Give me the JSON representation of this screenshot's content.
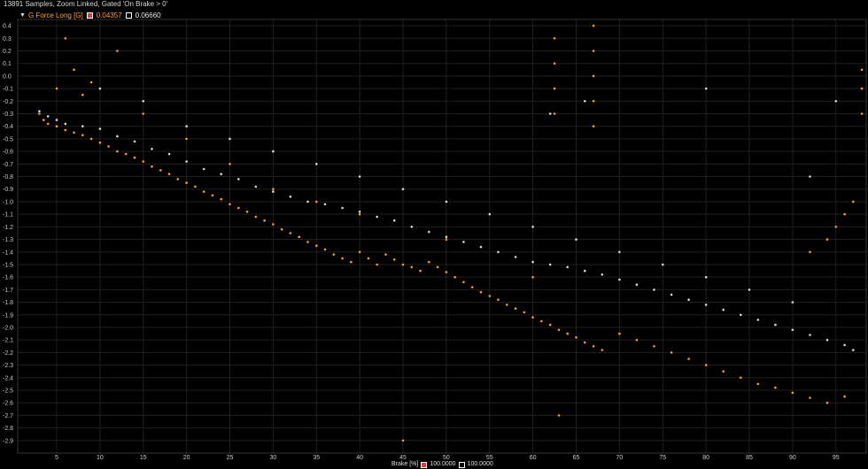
{
  "header": {
    "text": "13891 Samples, Zoom Linked, Gated 'On Brake > 0'"
  },
  "legend": {
    "arrow": "▼",
    "channel": "G Force Long [G]",
    "cursor_value_red": "0.04357",
    "cursor_value_white": "0.06660"
  },
  "x_footer": {
    "label": "Brake [%]",
    "cursor_value_red": "100.0000",
    "cursor_value_white": "100.0000"
  },
  "colors": {
    "background": "#000000",
    "grid": "#1f1f1f",
    "series_orange": "#ff9a2e",
    "series_white": "#d8d8d8"
  },
  "chart_data": {
    "type": "scatter",
    "title": "",
    "xlabel": "Brake [%]",
    "ylabel": "G Force Long [G]",
    "xlim": [
      0.5,
      98.5
    ],
    "ylim": [
      -3.0,
      0.45
    ],
    "grid": true,
    "xticks": [
      5,
      10,
      15,
      20,
      25,
      30,
      35,
      40,
      45,
      50,
      55,
      60,
      65,
      70,
      75,
      80,
      85,
      90,
      95
    ],
    "yticks": [
      0.4,
      0.3,
      0.2,
      0.1,
      0.0,
      -0.1,
      -0.2,
      -0.3,
      -0.4,
      -0.5,
      -0.6,
      -0.7,
      -0.8,
      -0.9,
      -1.0,
      -1.1,
      -1.2,
      -1.3,
      -1.4,
      -1.5,
      -1.6,
      -1.7,
      -1.8,
      -1.9,
      -2.0,
      -2.1,
      -2.2,
      -2.3,
      -2.4,
      -2.5,
      -2.6,
      -2.7,
      -2.8,
      -2.9
    ],
    "series": [
      {
        "color": "#ff9a2e",
        "points": [
          [
            3,
            -0.3
          ],
          [
            3.5,
            -0.35
          ],
          [
            4,
            -0.38
          ],
          [
            5,
            -0.4
          ],
          [
            6,
            -0.43
          ],
          [
            7,
            -0.45
          ],
          [
            8,
            -0.47
          ],
          [
            9,
            -0.5
          ],
          [
            10,
            -0.53
          ],
          [
            11,
            -0.56
          ],
          [
            12,
            -0.6
          ],
          [
            13,
            -0.62
          ],
          [
            14,
            -0.65
          ],
          [
            15,
            -0.68
          ],
          [
            16,
            -0.72
          ],
          [
            17,
            -0.75
          ],
          [
            18,
            -0.78
          ],
          [
            19,
            -0.82
          ],
          [
            20,
            -0.85
          ],
          [
            21,
            -0.88
          ],
          [
            22,
            -0.92
          ],
          [
            23,
            -0.95
          ],
          [
            24,
            -0.98
          ],
          [
            25,
            -1.02
          ],
          [
            26,
            -1.05
          ],
          [
            27,
            -1.08
          ],
          [
            28,
            -1.12
          ],
          [
            29,
            -1.15
          ],
          [
            30,
            -1.18
          ],
          [
            31,
            -1.22
          ],
          [
            32,
            -1.25
          ],
          [
            33,
            -1.28
          ],
          [
            34,
            -1.32
          ],
          [
            35,
            -1.35
          ],
          [
            36,
            -1.38
          ],
          [
            37,
            -1.42
          ],
          [
            38,
            -1.45
          ],
          [
            39,
            -1.48
          ],
          [
            40,
            -1.4
          ],
          [
            41,
            -1.45
          ],
          [
            42,
            -1.5
          ],
          [
            43,
            -1.42
          ],
          [
            44,
            -1.46
          ],
          [
            45,
            -1.5
          ],
          [
            46,
            -1.52
          ],
          [
            47,
            -1.55
          ],
          [
            48,
            -1.48
          ],
          [
            49,
            -1.52
          ],
          [
            50,
            -1.56
          ],
          [
            51,
            -1.6
          ],
          [
            52,
            -1.64
          ],
          [
            53,
            -1.68
          ],
          [
            54,
            -1.72
          ],
          [
            55,
            -1.75
          ],
          [
            56,
            -1.78
          ],
          [
            57,
            -1.82
          ],
          [
            58,
            -1.85
          ],
          [
            59,
            -1.88
          ],
          [
            60,
            -1.92
          ],
          [
            61,
            -1.95
          ],
          [
            62,
            -1.98
          ],
          [
            63,
            -2.02
          ],
          [
            64,
            -2.05
          ],
          [
            65,
            -2.08
          ],
          [
            66,
            -2.12
          ],
          [
            67,
            -2.15
          ],
          [
            68,
            -2.18
          ],
          [
            70,
            -2.05
          ],
          [
            72,
            -2.1
          ],
          [
            74,
            -2.15
          ],
          [
            76,
            -2.2
          ],
          [
            78,
            -2.25
          ],
          [
            80,
            -2.3
          ],
          [
            82,
            -2.35
          ],
          [
            84,
            -2.4
          ],
          [
            86,
            -2.45
          ],
          [
            88,
            -2.48
          ],
          [
            90,
            -2.52
          ],
          [
            92,
            -2.56
          ],
          [
            94,
            -2.6
          ],
          [
            96,
            -2.55
          ],
          [
            5,
            -0.1
          ],
          [
            7,
            0.05
          ],
          [
            9,
            -0.05
          ],
          [
            12,
            0.2
          ],
          [
            6,
            0.3
          ],
          [
            8,
            -0.15
          ],
          [
            15,
            -0.3
          ],
          [
            20,
            -0.5
          ],
          [
            25,
            -0.7
          ],
          [
            30,
            -0.9
          ],
          [
            35,
            -1.0
          ],
          [
            40,
            -1.1
          ],
          [
            50,
            -1.3
          ],
          [
            60,
            -1.6
          ],
          [
            62.5,
            0.3
          ],
          [
            62.5,
            0.1
          ],
          [
            62.5,
            -0.1
          ],
          [
            62.5,
            -0.3
          ],
          [
            67,
            0.4
          ],
          [
            67,
            0.2
          ],
          [
            67,
            0.0
          ],
          [
            67,
            -0.2
          ],
          [
            67,
            -0.4
          ],
          [
            95,
            -1.2
          ],
          [
            96,
            -1.1
          ],
          [
            97,
            -1.0
          ],
          [
            98,
            0.05
          ],
          [
            98,
            -0.1
          ],
          [
            98,
            -0.3
          ],
          [
            92,
            -1.4
          ],
          [
            94,
            -1.3
          ],
          [
            63,
            -2.7
          ],
          [
            45,
            -2.9
          ]
        ]
      },
      {
        "color": "#d8d8d8",
        "points": [
          [
            3,
            -0.28
          ],
          [
            4,
            -0.32
          ],
          [
            5,
            -0.35
          ],
          [
            6,
            -0.38
          ],
          [
            8,
            -0.4
          ],
          [
            10,
            -0.42
          ],
          [
            12,
            -0.48
          ],
          [
            14,
            -0.52
          ],
          [
            16,
            -0.58
          ],
          [
            18,
            -0.62
          ],
          [
            20,
            -0.68
          ],
          [
            22,
            -0.74
          ],
          [
            24,
            -0.78
          ],
          [
            26,
            -0.82
          ],
          [
            28,
            -0.88
          ],
          [
            30,
            -0.92
          ],
          [
            32,
            -0.96
          ],
          [
            34,
            -1.0
          ],
          [
            36,
            -1.02
          ],
          [
            38,
            -1.05
          ],
          [
            40,
            -1.08
          ],
          [
            42,
            -1.12
          ],
          [
            44,
            -1.15
          ],
          [
            46,
            -1.2
          ],
          [
            48,
            -1.24
          ],
          [
            50,
            -1.28
          ],
          [
            52,
            -1.32
          ],
          [
            54,
            -1.36
          ],
          [
            56,
            -1.4
          ],
          [
            58,
            -1.44
          ],
          [
            60,
            -1.48
          ],
          [
            62,
            -1.5
          ],
          [
            64,
            -1.52
          ],
          [
            66,
            -1.55
          ],
          [
            68,
            -1.58
          ],
          [
            70,
            -1.62
          ],
          [
            72,
            -1.66
          ],
          [
            74,
            -1.7
          ],
          [
            76,
            -1.74
          ],
          [
            78,
            -1.78
          ],
          [
            80,
            -1.82
          ],
          [
            82,
            -1.86
          ],
          [
            84,
            -1.9
          ],
          [
            86,
            -1.94
          ],
          [
            88,
            -1.98
          ],
          [
            90,
            -2.02
          ],
          [
            92,
            -2.06
          ],
          [
            94,
            -2.1
          ],
          [
            96,
            -2.14
          ],
          [
            97,
            -2.18
          ],
          [
            45,
            -0.9
          ],
          [
            50,
            -1.0
          ],
          [
            55,
            -1.1
          ],
          [
            60,
            -1.2
          ],
          [
            65,
            -1.3
          ],
          [
            70,
            -1.4
          ],
          [
            75,
            -1.5
          ],
          [
            80,
            -1.6
          ],
          [
            85,
            -1.7
          ],
          [
            90,
            -1.8
          ],
          [
            40,
            -0.8
          ],
          [
            35,
            -0.7
          ],
          [
            30,
            -0.6
          ],
          [
            25,
            -0.5
          ],
          [
            20,
            -0.4
          ],
          [
            15,
            -0.2
          ],
          [
            10,
            -0.1
          ],
          [
            62,
            -0.3
          ],
          [
            66,
            -0.2
          ],
          [
            80,
            -0.1
          ],
          [
            95,
            -0.2
          ],
          [
            92,
            -0.8
          ]
        ]
      }
    ]
  }
}
